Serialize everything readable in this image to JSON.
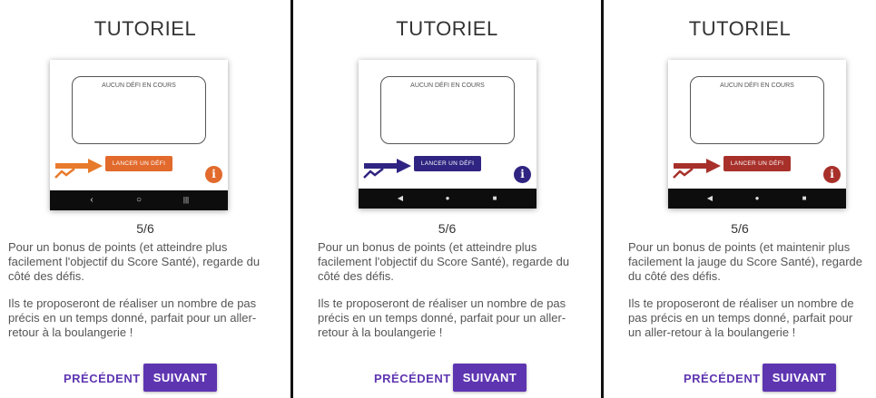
{
  "panels": [
    {
      "title": "TUTORIEL",
      "phone": {
        "challenge_text": "AUCUN DÉFI EN COURS",
        "lancer_label": "LANCER UN DÉFI",
        "info_glyph": "i",
        "accent_color": "#e87a2c",
        "button_color": "#e26a2c",
        "nav_icons": [
          "‹",
          "○",
          "|||"
        ]
      },
      "step": "5/6",
      "paragraph1": "Pour un bonus de points (et atteindre plus facilement l'objectif du Score Santé), regarde du côté des défis.",
      "paragraph2": "Ils te proposeront de réaliser un nombre de pas précis en un temps donné, parfait pour un aller-retour à la boulangerie !",
      "prev_label": "PRÉCÉDENT",
      "next_label": "SUIVANT"
    },
    {
      "title": "TUTORIEL",
      "phone": {
        "challenge_text": "AUCUN DÉFI EN COURS",
        "lancer_label": "LANCER UN DÉFI",
        "info_glyph": "i",
        "accent_color": "#2f2481",
        "button_color": "#2f2481",
        "nav_icons": [
          "◀",
          "●",
          "■"
        ]
      },
      "step": "5/6",
      "paragraph1": "Pour un bonus de points (et atteindre plus facilement l'objectif du Score Santé), regarde du côté des défis.",
      "paragraph2": "Ils te proposeront de réaliser un nombre de pas précis en un temps donné, parfait pour un aller-retour à la boulangerie !",
      "prev_label": "PRÉCÉDENT",
      "next_label": "SUIVANT"
    },
    {
      "title": "TUTORIEL",
      "phone": {
        "challenge_text": "AUCUN DÉFI EN COURS",
        "lancer_label": "LANCER UN DÉFI",
        "info_glyph": "i",
        "accent_color": "#a8302a",
        "button_color": "#a8302a",
        "nav_icons": [
          "◀",
          "●",
          "■"
        ]
      },
      "step": "5/6",
      "paragraph1": "Pour un bonus de points (et maintenir plus facilement la jauge du Score Santé), regarde du côté des défis.",
      "paragraph2": "Ils te proposeront de réaliser un nombre de pas précis en un temps donné, parfait pour un aller-retour à la boulangerie !",
      "prev_label": "PRÉCÉDENT",
      "next_label": "SUIVANT"
    }
  ],
  "colors": {
    "primary": "#5e35b1",
    "divider": "#111111"
  }
}
